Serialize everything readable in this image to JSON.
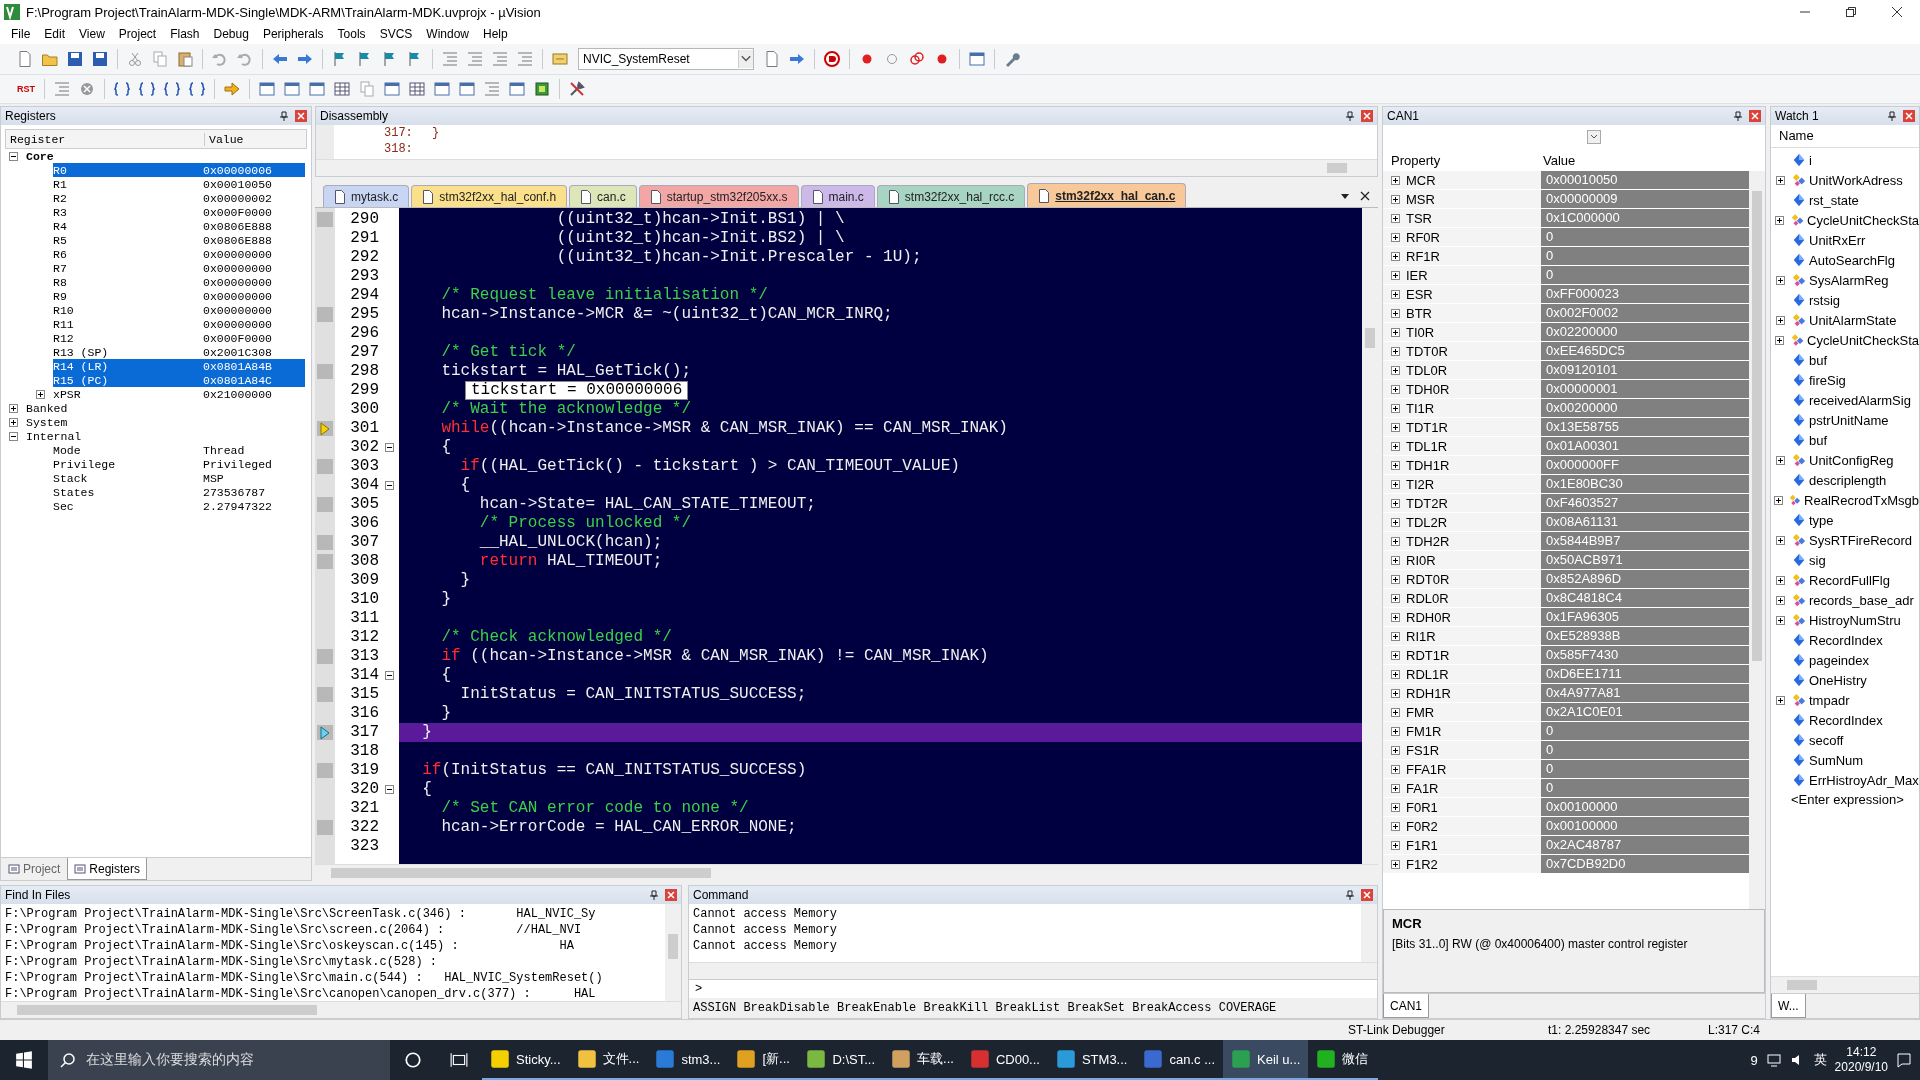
{
  "window": {
    "title": "F:\\Program Project\\TrainAlarm-MDK-Single\\MDK-ARM\\TrainAlarm-MDK.uvprojx - µVision"
  },
  "menu": [
    "File",
    "Edit",
    "View",
    "Project",
    "Flash",
    "Debug",
    "Peripherals",
    "Tools",
    "SVCS",
    "Window",
    "Help"
  ],
  "toolbar": {
    "target_dropdown": "NVIC_SystemReset",
    "reset_label": "RST"
  },
  "registers": {
    "title": "Registers",
    "columns": [
      "Register",
      "Value"
    ],
    "groups": [
      {
        "name": "Core",
        "expanded": true,
        "children": [
          {
            "name": "R0",
            "value": "0x00000006",
            "selected": true
          },
          {
            "name": "R1",
            "value": "0x00010050",
            "selected": false
          },
          {
            "name": "R2",
            "value": "0x00000002",
            "selected": false
          },
          {
            "name": "R3",
            "value": "0x000F0000",
            "selected": false
          },
          {
            "name": "R4",
            "value": "0x0806E888",
            "selected": false
          },
          {
            "name": "R5",
            "value": "0x0806E888",
            "selected": false
          },
          {
            "name": "R6",
            "value": "0x00000000",
            "selected": false
          },
          {
            "name": "R7",
            "value": "0x00000000",
            "selected": false
          },
          {
            "name": "R8",
            "value": "0x00000000",
            "selected": false
          },
          {
            "name": "R9",
            "value": "0x00000000",
            "selected": false
          },
          {
            "name": "R10",
            "value": "0x00000000",
            "selected": false
          },
          {
            "name": "R11",
            "value": "0x00000000",
            "selected": false
          },
          {
            "name": "R12",
            "value": "0x000F0000",
            "selected": false
          },
          {
            "name": "R13 (SP)",
            "value": "0x2001C308",
            "selected": false
          },
          {
            "name": "R14 (LR)",
            "value": "0x0801A84B",
            "selected": true
          },
          {
            "name": "R15 (PC)",
            "value": "0x0801A84C",
            "selected": true
          },
          {
            "name": "xPSR",
            "value": "0x21000000",
            "selected": false,
            "expanded": false
          }
        ]
      },
      {
        "name": "Banked",
        "expanded": false
      },
      {
        "name": "System",
        "expanded": false
      },
      {
        "name": "Internal",
        "expanded": true,
        "children": [
          {
            "name": "Mode",
            "value": "Thread",
            "selected": false
          },
          {
            "name": "Privilege",
            "value": "Privileged",
            "selected": false
          },
          {
            "name": "Stack",
            "value": "MSP",
            "selected": false
          },
          {
            "name": "States",
            "value": "273536787",
            "selected": false
          },
          {
            "name": "Sec",
            "value": "2.27947322",
            "selected": false
          }
        ]
      }
    ],
    "tabs": [
      {
        "label": "Project",
        "selected": false
      },
      {
        "label": "Registers",
        "selected": true
      }
    ]
  },
  "disassembly": {
    "title": "Disassembly",
    "lines": [
      {
        "addr": "317:",
        "code": "}"
      },
      {
        "addr": "318:"
      }
    ]
  },
  "editor": {
    "tabs": [
      {
        "label": "mytask.c",
        "color": "#c8d6f4",
        "selected": false
      },
      {
        "label": "stm32f2xx_hal_conf.h",
        "color": "#fbe08c",
        "selected": false
      },
      {
        "label": "can.c",
        "color": "#dce6b8",
        "selected": false
      },
      {
        "label": "startup_stm32f205xx.s",
        "color": "#f2a6a6",
        "selected": false
      },
      {
        "label": "main.c",
        "color": "#cdb8ea",
        "selected": false
      },
      {
        "label": "stm32f2xx_hal_rcc.c",
        "color": "#a8d4c4",
        "selected": false
      },
      {
        "label": "stm32f2xx_hal_can.c",
        "color": "#f9c898",
        "selected": true
      }
    ],
    "tooltip": "tickstart = 0x00000006",
    "lines": [
      {
        "num": "290",
        "exec": true,
        "fold": false,
        "current": false,
        "segments": [
          {
            "text": "                ((uint32_t)hcan->Init.BS1) | \\",
            "kind": "plain"
          }
        ]
      },
      {
        "num": "291",
        "exec": false,
        "fold": false,
        "current": false,
        "segments": [
          {
            "text": "                ((uint32_t)hcan->Init.BS2) | \\",
            "kind": "plain"
          }
        ]
      },
      {
        "num": "292",
        "exec": false,
        "fold": false,
        "current": false,
        "segments": [
          {
            "text": "                ((uint32_t)hcan->Init.Prescaler - 1U);",
            "kind": "plain"
          }
        ]
      },
      {
        "num": "293",
        "exec": false,
        "fold": false,
        "current": false
      },
      {
        "num": "294",
        "exec": false,
        "fold": false,
        "current": false,
        "segments": [
          {
            "text": "    /* Request leave initialisation */",
            "kind": "comment"
          }
        ]
      },
      {
        "num": "295",
        "exec": true,
        "fold": false,
        "current": false,
        "segments": [
          {
            "text": "    hcan->Instance->MCR &= ~(uint32_t)CAN_MCR_INRQ;",
            "kind": "plain"
          }
        ]
      },
      {
        "num": "296",
        "exec": false,
        "fold": false,
        "current": false
      },
      {
        "num": "297",
        "exec": false,
        "fold": false,
        "current": false,
        "segments": [
          {
            "text": "    /* Get tick */",
            "kind": "comment"
          }
        ]
      },
      {
        "num": "298",
        "exec": true,
        "fold": false,
        "current": false,
        "segments": [
          {
            "text": "    tickstart = HAL_GetTick();",
            "kind": "plain"
          }
        ]
      },
      {
        "num": "299",
        "exec": false,
        "fold": false,
        "current": false
      },
      {
        "num": "300",
        "exec": false,
        "fold": false,
        "current": false,
        "segments": [
          {
            "text": "    /* Wait the acknowledge */",
            "kind": "comment"
          }
        ]
      },
      {
        "num": "301",
        "exec": true,
        "fold": false,
        "current": false,
        "pc": true,
        "segments": [
          {
            "text": "    while",
            "kind": "keyword"
          },
          {
            "text": "((hcan->Instance->MSR & CAN_MSR_INAK) == CAN_MSR_INAK)",
            "kind": "plain"
          }
        ]
      },
      {
        "num": "302",
        "exec": false,
        "fold": true,
        "current": false,
        "segments": [
          {
            "text": "    {",
            "kind": "plain"
          }
        ]
      },
      {
        "num": "303",
        "exec": true,
        "fold": false,
        "current": false,
        "segments": [
          {
            "text": "      if",
            "kind": "keyword"
          },
          {
            "text": "((HAL_GetTick() - tickstart ) > CAN_TIMEOUT_VALUE)",
            "kind": "plain"
          }
        ]
      },
      {
        "num": "304",
        "exec": false,
        "fold": true,
        "current": false,
        "segments": [
          {
            "text": "      {",
            "kind": "plain"
          }
        ]
      },
      {
        "num": "305",
        "exec": true,
        "fold": false,
        "current": false,
        "segments": [
          {
            "text": "        hcan->State= HAL_CAN_STATE_TIMEOUT;",
            "kind": "plain"
          }
        ]
      },
      {
        "num": "306",
        "exec": false,
        "fold": false,
        "current": false,
        "segments": [
          {
            "text": "        /* Process unlocked */",
            "kind": "comment"
          }
        ]
      },
      {
        "num": "307",
        "exec": true,
        "fold": false,
        "current": false,
        "segments": [
          {
            "text": "        __HAL_UNLOCK(hcan);",
            "kind": "plain"
          }
        ]
      },
      {
        "num": "308",
        "exec": true,
        "fold": false,
        "current": false,
        "segments": [
          {
            "text": "        return",
            "kind": "keyword"
          },
          {
            "text": " HAL_TIMEOUT;",
            "kind": "plain"
          }
        ]
      },
      {
        "num": "309",
        "exec": false,
        "fold": false,
        "current": false,
        "segments": [
          {
            "text": "      }",
            "kind": "plain"
          }
        ]
      },
      {
        "num": "310",
        "exec": false,
        "fold": false,
        "current": false,
        "segments": [
          {
            "text": "    }",
            "kind": "plain"
          }
        ]
      },
      {
        "num": "311",
        "exec": false,
        "fold": false,
        "current": false
      },
      {
        "num": "312",
        "exec": false,
        "fold": false,
        "current": false,
        "segments": [
          {
            "text": "    /* Check acknowledged */",
            "kind": "comment"
          }
        ]
      },
      {
        "num": "313",
        "exec": true,
        "fold": false,
        "current": false,
        "segments": [
          {
            "text": "    if",
            "kind": "keyword"
          },
          {
            "text": " ((hcan->Instance->MSR & CAN_MSR_INAK) != CAN_MSR_INAK)",
            "kind": "plain"
          }
        ]
      },
      {
        "num": "314",
        "exec": false,
        "fold": true,
        "current": false,
        "segments": [
          {
            "text": "    {",
            "kind": "plain"
          }
        ]
      },
      {
        "num": "315",
        "exec": true,
        "fold": false,
        "current": false,
        "segments": [
          {
            "text": "      InitStatus = CAN_INITSTATUS_SUCCESS;",
            "kind": "plain"
          }
        ]
      },
      {
        "num": "316",
        "exec": false,
        "fold": false,
        "current": false,
        "segments": [
          {
            "text": "    }",
            "kind": "plain"
          }
        ]
      },
      {
        "num": "317",
        "exec": true,
        "fold": false,
        "current": true,
        "segments": [
          {
            "text": "  }",
            "kind": "plain"
          }
        ]
      },
      {
        "num": "318",
        "exec": false,
        "fold": false,
        "current": false
      },
      {
        "num": "319",
        "exec": true,
        "fold": false,
        "current": false,
        "segments": [
          {
            "text": "  if",
            "kind": "keyword"
          },
          {
            "text": "(InitStatus == CAN_INITSTATUS_SUCCESS)",
            "kind": "plain"
          }
        ]
      },
      {
        "num": "320",
        "exec": false,
        "fold": true,
        "current": false,
        "segments": [
          {
            "text": "  {",
            "kind": "plain"
          }
        ]
      },
      {
        "num": "321",
        "exec": false,
        "fold": false,
        "current": false,
        "segments": [
          {
            "text": "    /* Set CAN error code to none */",
            "kind": "comment"
          }
        ]
      },
      {
        "num": "322",
        "exec": true,
        "fold": false,
        "current": false,
        "segments": [
          {
            "text": "    hcan->ErrorCode = HAL_CAN_ERROR_NONE;",
            "kind": "plain"
          }
        ]
      },
      {
        "num": "323",
        "exec": false,
        "fold": false,
        "current": false
      }
    ]
  },
  "find_in_files": {
    "title": "Find In Files",
    "lines": [
      "F:\\Program Project\\TrainAlarm-MDK-Single\\Src\\ScreenTask.c(346) :       HAL_NVIC_Sy",
      "F:\\Program Project\\TrainAlarm-MDK-Single\\Src\\screen.c(2064) :          //HAL_NVI",
      "F:\\Program Project\\TrainAlarm-MDK-Single\\Src\\oskeyscan.c(145) :              HA",
      "F:\\Program Project\\TrainAlarm-MDK-Single\\Src\\mytask.c(528) :",
      "F:\\Program Project\\TrainAlarm-MDK-Single\\Src\\main.c(544) :   HAL_NVIC_SystemReset()",
      "F:\\Program Project\\TrainAlarm-MDK-Single\\Src\\canopen\\canopen_drv.c(377) :      HAL"
    ]
  },
  "command": {
    "title": "Command",
    "output": [
      "Cannot access Memory",
      "Cannot access Memory",
      "Cannot access Memory"
    ],
    "prompt": ">",
    "hint": "ASSIGN BreakDisable BreakEnable BreakKill BreakList BreakSet BreakAccess COVERAGE"
  },
  "can1": {
    "title": "CAN1",
    "columns": [
      "Property",
      "Value"
    ],
    "registers": [
      {
        "name": "MCR",
        "value": "0x00010050"
      },
      {
        "name": "MSR",
        "value": "0x00000009"
      },
      {
        "name": "TSR",
        "value": "0x1C000000"
      },
      {
        "name": "RF0R",
        "value": "0"
      },
      {
        "name": "RF1R",
        "value": "0"
      },
      {
        "name": "IER",
        "value": "0"
      },
      {
        "name": "ESR",
        "value": "0xFF000023"
      },
      {
        "name": "BTR",
        "value": "0x002F0002"
      },
      {
        "name": "TI0R",
        "value": "0x02200000"
      },
      {
        "name": "TDT0R",
        "value": "0xEE465DC5"
      },
      {
        "name": "TDL0R",
        "value": "0x09120101"
      },
      {
        "name": "TDH0R",
        "value": "0x00000001"
      },
      {
        "name": "TI1R",
        "value": "0x00200000"
      },
      {
        "name": "TDT1R",
        "value": "0x13E58755"
      },
      {
        "name": "TDL1R",
        "value": "0x01A00301"
      },
      {
        "name": "TDH1R",
        "value": "0x000000FF"
      },
      {
        "name": "TI2R",
        "value": "0x1E80BC30"
      },
      {
        "name": "TDT2R",
        "value": "0xF4603527"
      },
      {
        "name": "TDL2R",
        "value": "0x08A61131"
      },
      {
        "name": "TDH2R",
        "value": "0x5844B9B7"
      },
      {
        "name": "RI0R",
        "value": "0x50ACB971"
      },
      {
        "name": "RDT0R",
        "value": "0x852A896D"
      },
      {
        "name": "RDL0R",
        "value": "0x8C4818C4"
      },
      {
        "name": "RDH0R",
        "value": "0x1FA96305"
      },
      {
        "name": "RI1R",
        "value": "0xE528938B"
      },
      {
        "name": "RDT1R",
        "value": "0x585F7430"
      },
      {
        "name": "RDL1R",
        "value": "0xD6EE1711"
      },
      {
        "name": "RDH1R",
        "value": "0x4A977A81"
      },
      {
        "name": "FMR",
        "value": "0x2A1C0E01"
      },
      {
        "name": "FM1R",
        "value": "0"
      },
      {
        "name": "FS1R",
        "value": "0"
      },
      {
        "name": "FFA1R",
        "value": "0"
      },
      {
        "name": "FA1R",
        "value": "0"
      },
      {
        "name": "F0R1",
        "value": "0x00100000"
      },
      {
        "name": "F0R2",
        "value": "0x00100000"
      },
      {
        "name": "F1R1",
        "value": "0x2AC48787"
      },
      {
        "name": "F1R2",
        "value": "0x7CDB92D0"
      }
    ],
    "detail_title": "MCR",
    "detail_text": "[Bits 31..0] RW (@ 0x40006400) master control register",
    "tab": "CAN1"
  },
  "watch": {
    "title": "Watch 1",
    "column": "Name",
    "items": [
      {
        "name": "i",
        "kind": "scalar"
      },
      {
        "name": "UnitWorkAdress",
        "kind": "struct"
      },
      {
        "name": "rst_state",
        "kind": "scalar"
      },
      {
        "name": "CycleUnitCheckSta",
        "kind": "struct"
      },
      {
        "name": "UnitRxErr",
        "kind": "scalar"
      },
      {
        "name": "AutoSearchFlg",
        "kind": "scalar"
      },
      {
        "name": "SysAlarmReg",
        "kind": "struct"
      },
      {
        "name": "rstsig",
        "kind": "scalar"
      },
      {
        "name": "UnitAlarmState",
        "kind": "struct"
      },
      {
        "name": "CycleUnitCheckSta",
        "kind": "struct"
      },
      {
        "name": "buf",
        "kind": "scalar"
      },
      {
        "name": "fireSig",
        "kind": "scalar"
      },
      {
        "name": "receivedAlarmSig",
        "kind": "scalar"
      },
      {
        "name": "pstrUnitName",
        "kind": "scalar"
      },
      {
        "name": "buf",
        "kind": "scalar"
      },
      {
        "name": "UnitConfigReg",
        "kind": "struct"
      },
      {
        "name": "descriplength",
        "kind": "scalar"
      },
      {
        "name": "RealRecrodTxMsgb",
        "kind": "struct"
      },
      {
        "name": "type",
        "kind": "scalar"
      },
      {
        "name": "SysRTFireRecord",
        "kind": "struct"
      },
      {
        "name": "sig",
        "kind": "scalar"
      },
      {
        "name": "RecordFullFlg",
        "kind": "struct"
      },
      {
        "name": "records_base_adr",
        "kind": "struct"
      },
      {
        "name": "HistroyNumStru",
        "kind": "struct"
      },
      {
        "name": "RecordIndex",
        "kind": "scalar"
      },
      {
        "name": "pageindex",
        "kind": "scalar"
      },
      {
        "name": "OneHistry",
        "kind": "scalar"
      },
      {
        "name": "tmpadr",
        "kind": "struct"
      },
      {
        "name": "RecordIndex",
        "kind": "scalar"
      },
      {
        "name": "secoff",
        "kind": "scalar"
      },
      {
        "name": "SumNum",
        "kind": "scalar"
      },
      {
        "name": "ErrHistroyAdr_Max",
        "kind": "scalar"
      }
    ],
    "enter_expression": "<Enter expression>",
    "tab": "W..."
  },
  "status_bar": {
    "debugger": "ST-Link Debugger",
    "time": "t1: 2.25928347 sec",
    "position": "L:317 C:4"
  },
  "taskbar": {
    "search_placeholder": "在这里输入你要搜索的内容",
    "apps": [
      {
        "label": "Sticky...",
        "selected": false
      },
      {
        "label": "文件...",
        "selected": false
      },
      {
        "label": "stm3...",
        "selected": false
      },
      {
        "label": "[新...",
        "selected": false
      },
      {
        "label": "D:\\ST...",
        "selected": false
      },
      {
        "label": "车载...",
        "selected": false
      },
      {
        "label": "CD00...",
        "selected": false
      },
      {
        "label": "STM3...",
        "selected": false
      },
      {
        "label": "can.c ...",
        "selected": false
      },
      {
        "label": "Keil u...",
        "selected": true
      },
      {
        "label": "微信",
        "selected": false
      }
    ],
    "tray_count": "9",
    "ime": "英",
    "time": "14:12",
    "date": "2020/9/10"
  }
}
